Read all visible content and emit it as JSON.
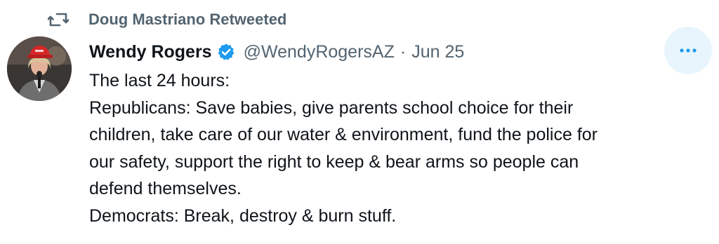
{
  "retweet": {
    "text": "Doug Mastriano Retweeted",
    "icon": "retweet-icon"
  },
  "author": {
    "name": "Wendy Rogers",
    "handle": "@WendyRogersAZ",
    "separator": "·",
    "date": "Jun 25",
    "verified_icon": "verified-badge-icon",
    "avatar": "avatar"
  },
  "tweet": {
    "lines": [
      "The last 24 hours:",
      "Republicans: Save babies, give parents school choice for their",
      "children, take care of our water & environment, fund the police for",
      "our safety, support the right to keep & bear arms so people can",
      "defend themselves.",
      "Democrats: Break, destroy & burn stuff."
    ]
  },
  "more": {
    "icon": "more-horizontal-icon"
  },
  "colors": {
    "text_primary": "#0f1419",
    "text_secondary": "#536471",
    "verified_blue": "#1d9bf0",
    "more_button_bg": "#e8f5fd",
    "hat_red": "#d62828"
  }
}
